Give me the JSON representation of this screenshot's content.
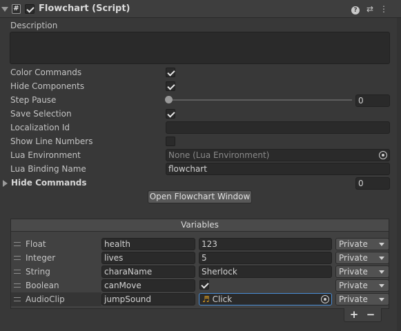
{
  "header": {
    "script_icon_glyph": "#",
    "title": "Flowchart (Script)",
    "enabled": true,
    "icons": [
      "help-icon",
      "preset-icon",
      "more-menu-icon"
    ],
    "help_glyph": "?",
    "preset_glyph": "⇄",
    "more_glyph": "⋮"
  },
  "fields": {
    "description_label": "Description",
    "color_commands_label": "Color Commands",
    "hide_components_label": "Hide Components",
    "step_pause_label": "Step Pause",
    "step_pause_value": "0",
    "save_selection_label": "Save Selection",
    "localization_id_label": "Localization Id",
    "show_line_numbers_label": "Show Line Numbers",
    "lua_environment_label": "Lua Environment",
    "lua_environment_value": "None (Lua Environment)",
    "lua_binding_name_label": "Lua Binding Name",
    "lua_binding_name_value": "flowchart",
    "hide_commands_label": "Hide Commands",
    "hide_commands_count": "0"
  },
  "open_window_button": "Open Flowchart Window",
  "variables": {
    "header": "Variables",
    "rows": [
      {
        "type": "Float",
        "key": "health",
        "value": "123",
        "scope": "Private"
      },
      {
        "type": "Integer",
        "key": "lives",
        "value": "5",
        "scope": "Private"
      },
      {
        "type": "String",
        "key": "charaName",
        "value": "Sherlock",
        "scope": "Private"
      },
      {
        "type": "Boolean",
        "key": "canMove",
        "value": "",
        "scope": "Private"
      },
      {
        "type": "AudioClip",
        "key": "jumpSound",
        "value": "Click",
        "scope": "Private"
      }
    ],
    "add_glyph": "+",
    "remove_glyph": "−",
    "audio_glyph": "♬"
  },
  "colors": {
    "background": "#383838",
    "field": "#2a2a2a",
    "focus_outline": "#4a8ed8",
    "audio_note": "#e0a020"
  }
}
